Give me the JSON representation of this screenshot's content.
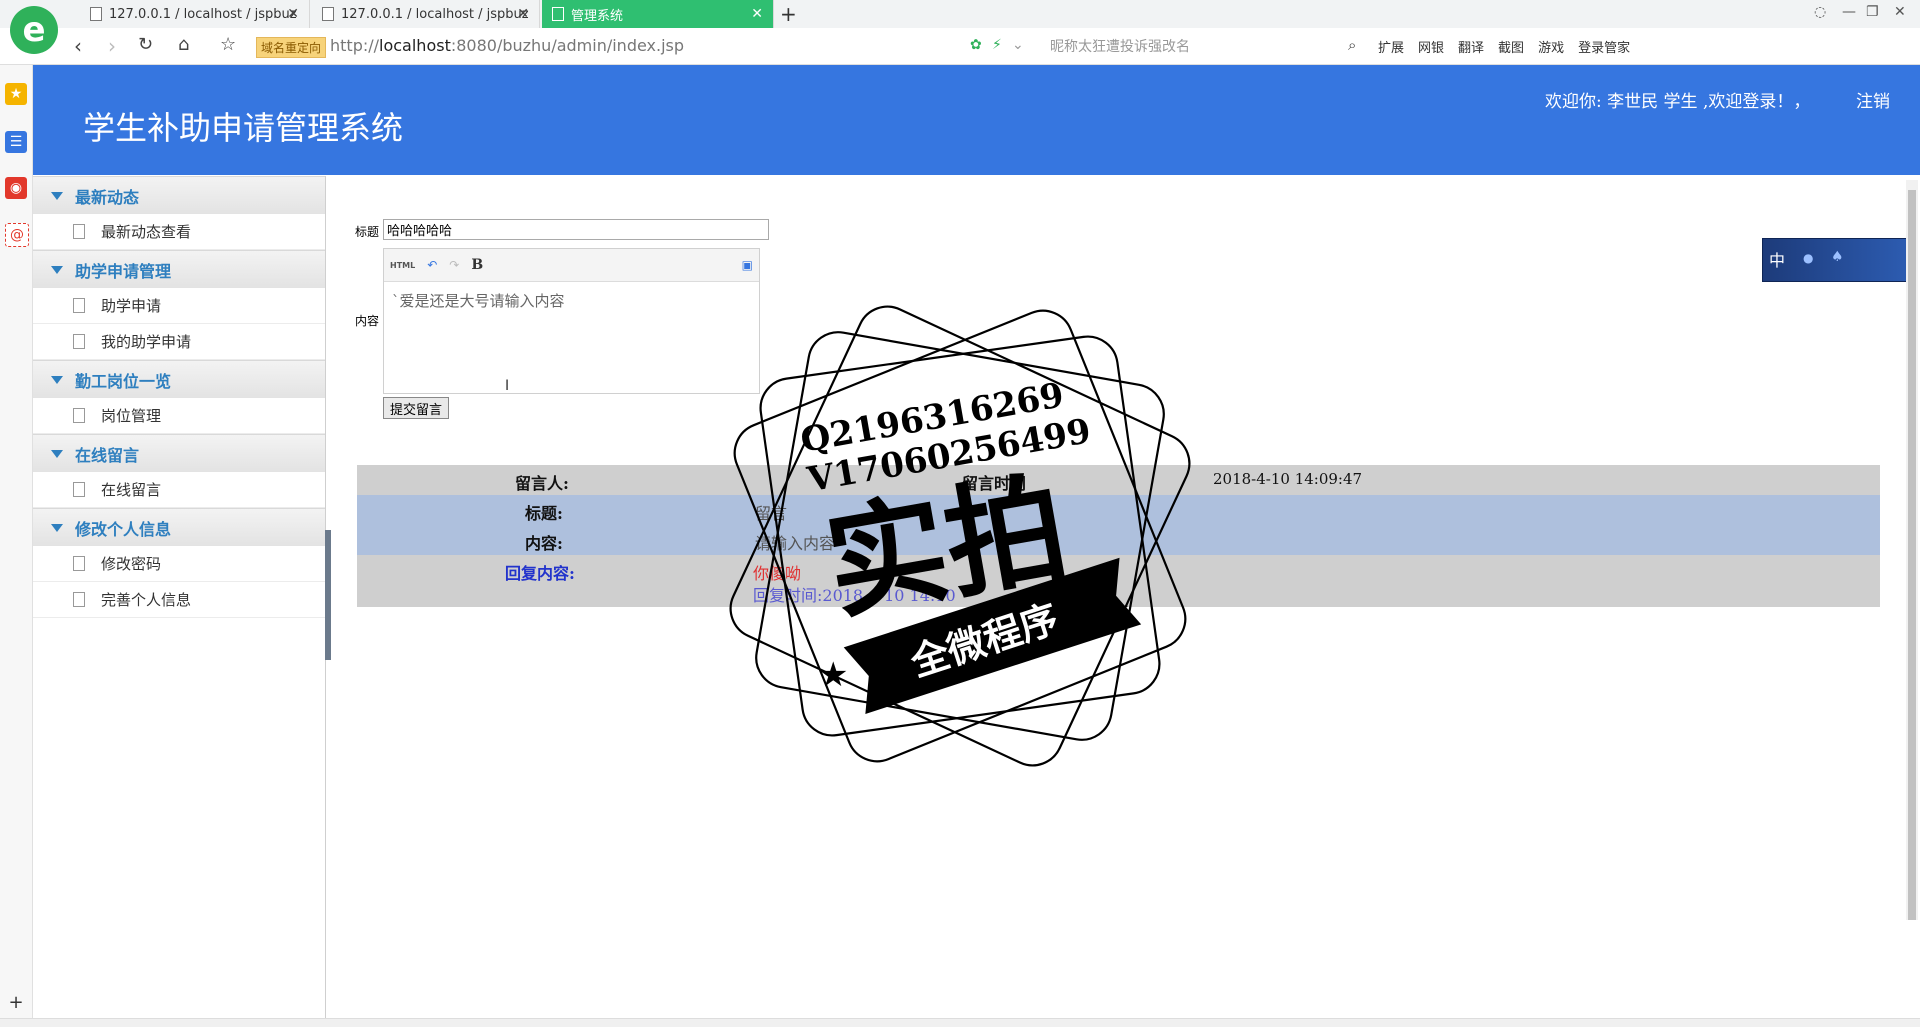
{
  "browser": {
    "tabs": [
      {
        "label": "127.0.0.1 / localhost / jspbuz"
      },
      {
        "label": "127.0.0.1 / localhost / jspbuz"
      },
      {
        "label": "管理系统"
      }
    ],
    "new_tab": "+",
    "redirect_badge": "域名重定向",
    "url_prefix": "http://",
    "url_host": "localhost",
    "url_rest": ":8080/buzhu/admin/index.jsp",
    "search_placeholder": "昵称太狂遭投诉强改名",
    "tools": [
      "扩展",
      "网银",
      "翻译",
      "截图",
      "游戏",
      "登录管家"
    ]
  },
  "header": {
    "title": "学生补助申请管理系统",
    "welcome": "欢迎你: 李世民 学生 ,欢迎登录！，",
    "logout": "注销"
  },
  "sidebar": {
    "groups": [
      {
        "title": "最新动态",
        "items": [
          "最新动态查看"
        ]
      },
      {
        "title": "助学申请管理",
        "items": [
          "助学申请",
          "我的助学申请"
        ]
      },
      {
        "title": "勤工岗位一览",
        "items": [
          "岗位管理"
        ]
      },
      {
        "title": "在线留言",
        "items": [
          "在线留言"
        ]
      },
      {
        "title": "修改个人信息",
        "items": [
          "修改密码",
          "完善个人信息"
        ]
      }
    ]
  },
  "form": {
    "title_label": "标题",
    "title_value": "哈哈哈哈哈",
    "content_label": "内容",
    "content_value": "`爱是还是大号请输入内容",
    "submit_label": "提交留言",
    "toolbar": {
      "html": "HTML",
      "bold": "B"
    }
  },
  "message": {
    "author_label": "留言人:",
    "time_label": "留言时间",
    "time_value": "2018-4-10 14:09:47",
    "title_label": "标题:",
    "title_value": "留言",
    "content_label": "内容:",
    "content_value": "请输入内容",
    "reply_label": "回复内容:",
    "reply_value": "你傻呦",
    "reply_time": "回复时间:2018-4-10 14:10"
  },
  "widget": {
    "label": "中"
  },
  "watermark": {
    "line1": "Q2196316269",
    "line2": "V17060256499",
    "main": "实拍",
    "banner": "全微程序"
  },
  "colors": {
    "header": "#3676e0",
    "menu_text": "#2e7fbf",
    "row_blue": "#aec0dd",
    "row_gray": "#cfcfcf"
  }
}
